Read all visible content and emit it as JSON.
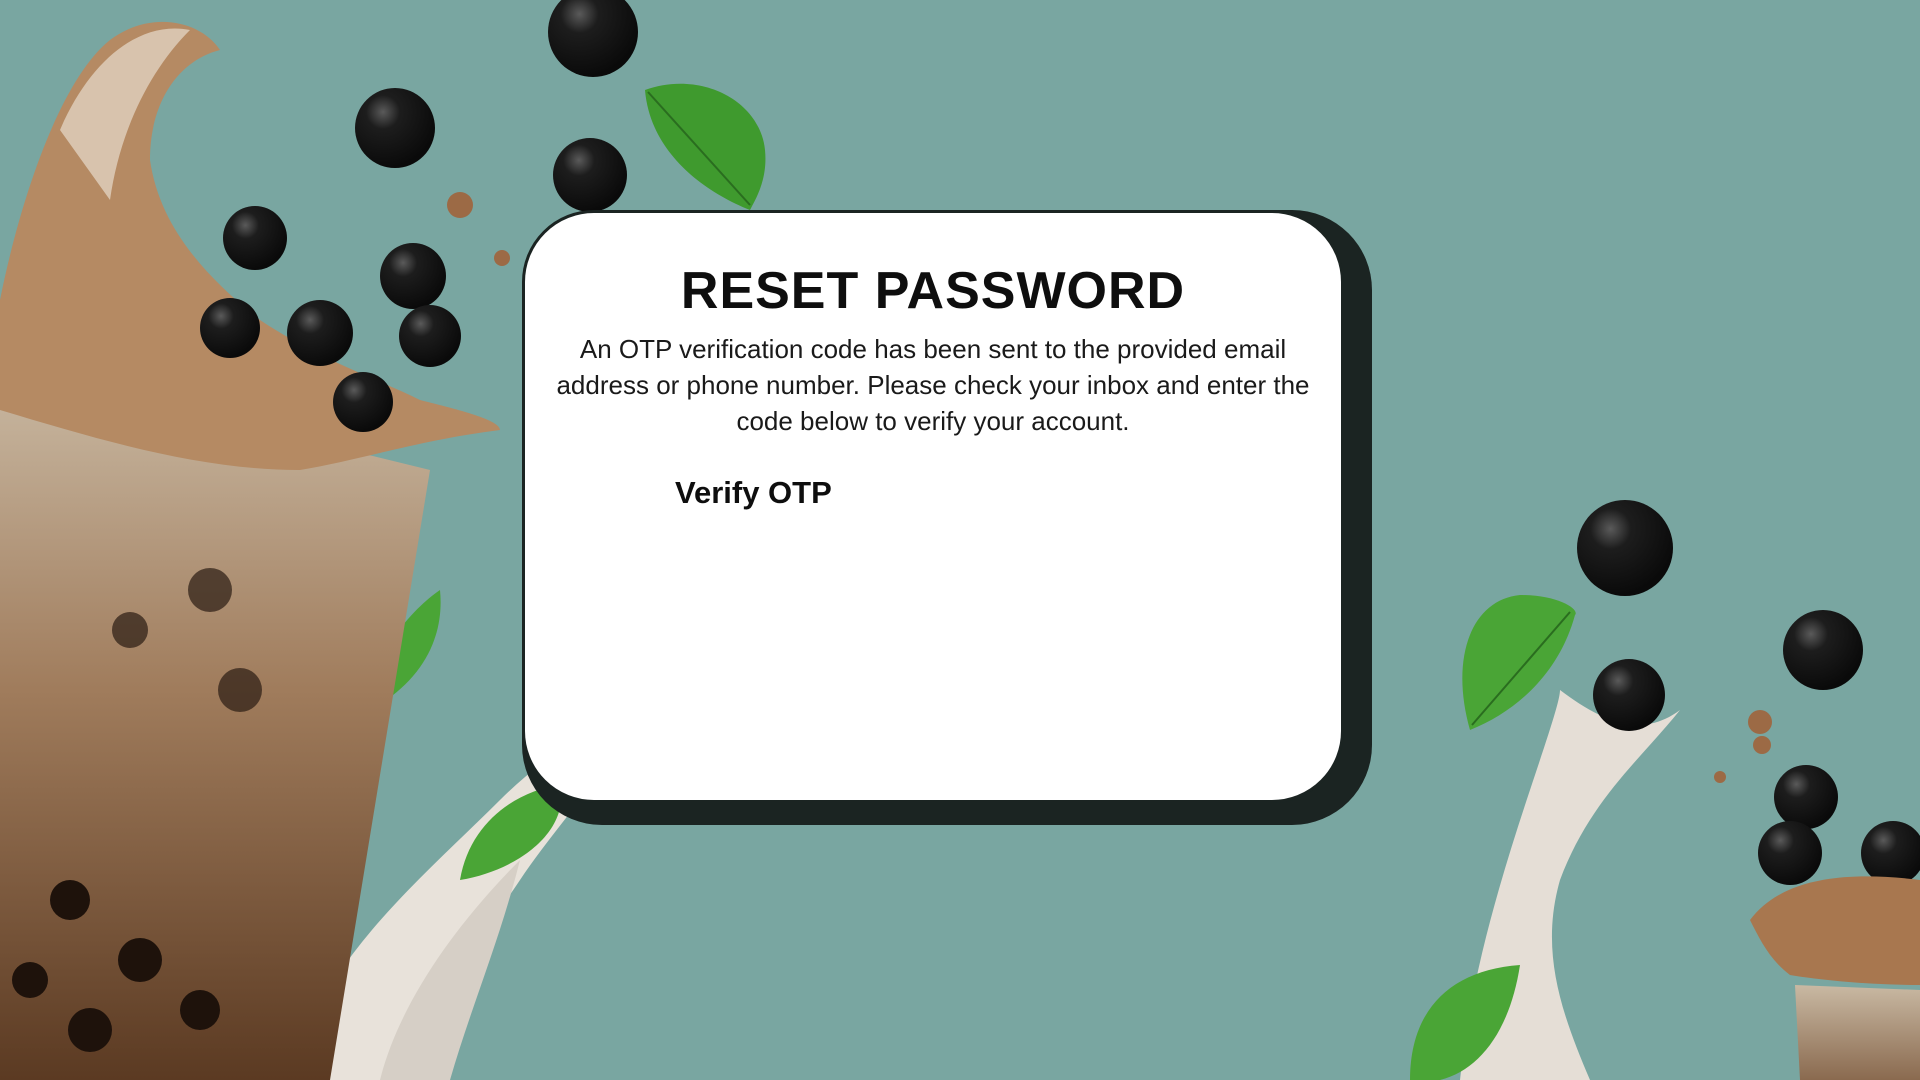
{
  "colors": {
    "background": "#79a6a1",
    "card": "#ffffff",
    "card_shadow": "#1b2422",
    "text": "#0e0e0e"
  },
  "reset": {
    "title": "RESET PASSWORD",
    "description": "An OTP verification code has been sent to the provided email address or phone number. Please check your inbox and enter the code below to verify your account.",
    "verify_label": "Verify OTP"
  }
}
